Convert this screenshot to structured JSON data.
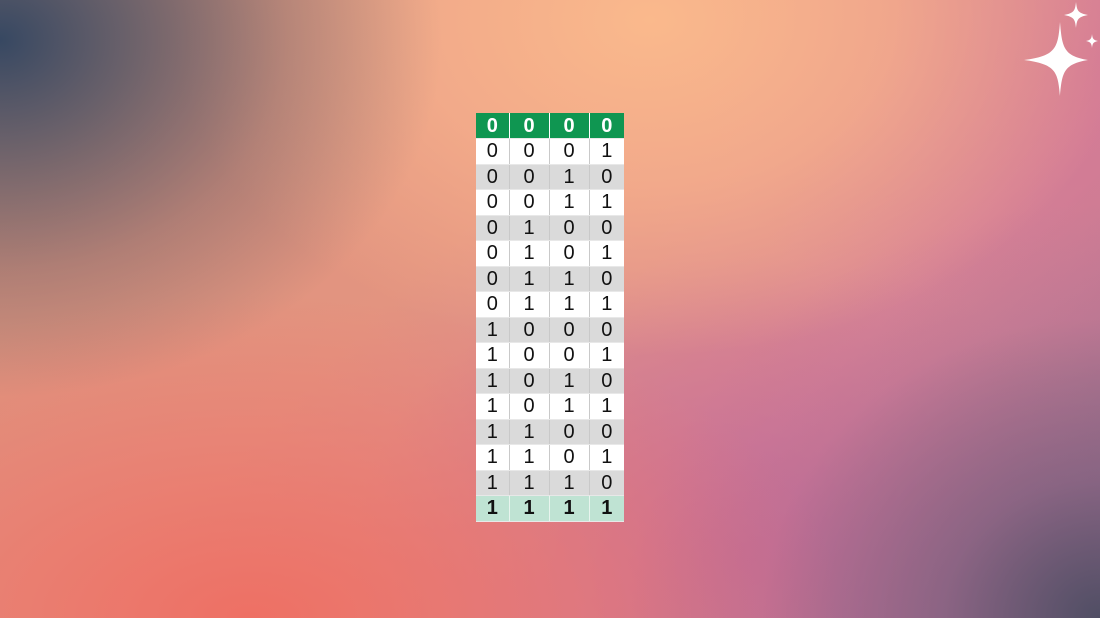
{
  "background": {
    "colors": [
      "#3e4d66",
      "#f6b48c",
      "#ee7062",
      "#c46e9a",
      "#5b5570"
    ]
  },
  "decoration": {
    "icon": "sparkles-icon",
    "color": "#ffffff"
  },
  "truth_table": {
    "header_row": [
      "0",
      "0",
      "0",
      "0"
    ],
    "rows": [
      [
        "0",
        "0",
        "0",
        "1"
      ],
      [
        "0",
        "0",
        "1",
        "0"
      ],
      [
        "0",
        "0",
        "1",
        "1"
      ],
      [
        "0",
        "1",
        "0",
        "0"
      ],
      [
        "0",
        "1",
        "0",
        "1"
      ],
      [
        "0",
        "1",
        "1",
        "0"
      ],
      [
        "0",
        "1",
        "1",
        "1"
      ],
      [
        "1",
        "0",
        "0",
        "0"
      ],
      [
        "1",
        "0",
        "0",
        "1"
      ],
      [
        "1",
        "0",
        "1",
        "0"
      ],
      [
        "1",
        "0",
        "1",
        "1"
      ],
      [
        "1",
        "1",
        "0",
        "0"
      ],
      [
        "1",
        "1",
        "0",
        "1"
      ],
      [
        "1",
        "1",
        "1",
        "0"
      ]
    ],
    "last_row": [
      "1",
      "1",
      "1",
      "1"
    ],
    "colors": {
      "header_bg": "#0f9651",
      "header_text": "#ffffff",
      "stripe_light": "#ffffff",
      "stripe_dark": "#dadada",
      "last_row_bg": "#bfe3d3"
    }
  }
}
